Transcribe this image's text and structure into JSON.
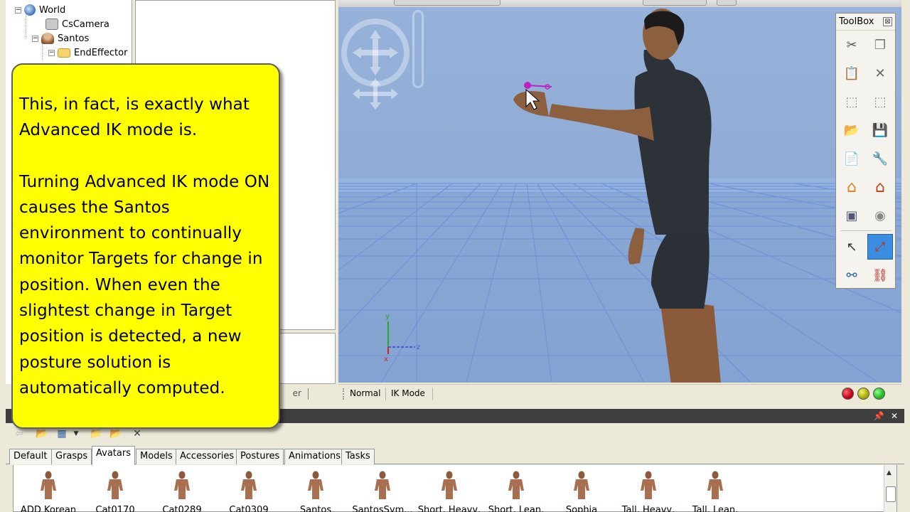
{
  "scene_tree": {
    "items": [
      {
        "label": "World",
        "icon": "globe-icon"
      },
      {
        "label": "CsCamera",
        "icon": "camera-icon"
      },
      {
        "label": "Santos",
        "icon": "avatar-icon"
      },
      {
        "label": "EndEffector",
        "icon": "folder-icon"
      }
    ]
  },
  "callout": {
    "paragraph1": "This, in fact, is exactly what Advanced IK mode is.",
    "paragraph2": "Turning Advanced IK mode ON causes the Santos environment to continually monitor Targets for change in position.  When even the slightest change in Target position is detected, a new posture solution is automatically computed."
  },
  "left_tab_fragment": "er",
  "viewport": {
    "axis_labels": {
      "x": "x",
      "y": "y",
      "z": "z"
    }
  },
  "status_bar": {
    "mode_normal": "Normal",
    "mode_ik": "IK Mode",
    "lights": [
      "#c0001a",
      "#b8b800",
      "#22b822"
    ]
  },
  "toolbox": {
    "title": "ToolBox",
    "close_label": "⊠",
    "buttons": [
      {
        "name": "cut-icon",
        "glyph": "✂"
      },
      {
        "name": "copy-icon",
        "glyph": "❐"
      },
      {
        "name": "paste-icon",
        "glyph": "📋"
      },
      {
        "name": "delete-icon",
        "glyph": "✕"
      },
      {
        "name": "select-frame-icon",
        "glyph": "⬚"
      },
      {
        "name": "fit-frame-icon",
        "glyph": "⬚"
      },
      {
        "name": "open-folder-icon",
        "glyph": "📂"
      },
      {
        "name": "save-icon",
        "glyph": "💾"
      },
      {
        "name": "clipboard-icon",
        "glyph": "📄"
      },
      {
        "name": "tools-icon",
        "glyph": "🔧"
      },
      {
        "name": "home-icon",
        "glyph": "⌂"
      },
      {
        "name": "home-settings-icon",
        "glyph": "⌂"
      },
      {
        "name": "screenshot-icon",
        "glyph": "▣"
      },
      {
        "name": "eye-icon",
        "glyph": "◉"
      },
      {
        "name": "pointer-icon",
        "glyph": "↖"
      },
      {
        "name": "ik-target-icon",
        "glyph": "⤢"
      },
      {
        "name": "skeleton-icon",
        "glyph": "⚯"
      },
      {
        "name": "link-icon",
        "glyph": "⛓"
      }
    ]
  },
  "dock": {
    "pin_label": "📌",
    "close_label": "✕",
    "tabs": [
      "Default",
      "Grasps",
      "Avatars",
      "Models",
      "Accessories",
      "Postures",
      "Animations",
      "Tasks"
    ],
    "active_tab": "Avatars",
    "gallery": [
      "ADD Korean",
      "Cat0170",
      "Cat0289",
      "Cat0309",
      "Santos",
      "SantosSym...",
      "Short, Heavy,",
      "Short, Lean,",
      "Sophia",
      "Tall, Heavy,",
      "Tall, Lean,"
    ]
  }
}
